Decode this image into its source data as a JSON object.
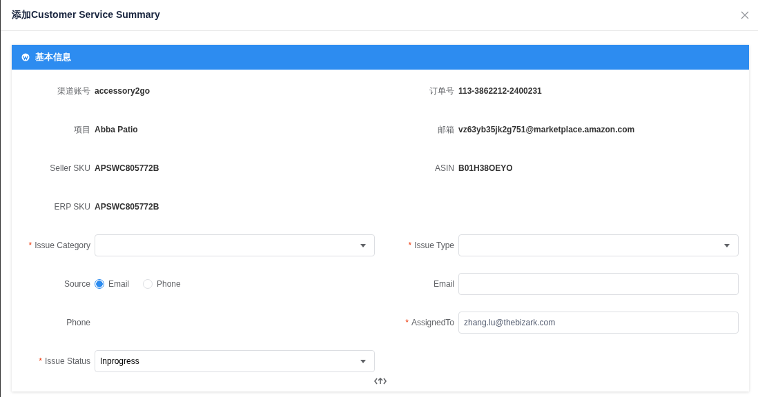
{
  "dialog": {
    "title": "添加Customer Service Summary"
  },
  "section": {
    "title": "基本信息"
  },
  "rows": [
    {
      "left": {
        "kind": "text",
        "label": "渠道账号",
        "value": "accessory2go"
      },
      "right": {
        "kind": "text",
        "label": "订单号",
        "value": "113-3862212-2400231"
      }
    },
    {
      "left": {
        "kind": "text",
        "label": "项目",
        "value": "Abba Patio"
      },
      "right": {
        "kind": "text",
        "label": "邮箱",
        "value": "vz63yb35jk2g751@marketplace.amazon.com"
      }
    },
    {
      "left": {
        "kind": "text",
        "label": "Seller SKU",
        "value": "APSWC805772B"
      },
      "right": {
        "kind": "text",
        "label": "ASIN",
        "value": "B01H38OEYO"
      }
    },
    {
      "left": {
        "kind": "text",
        "label": "ERP SKU",
        "value": "APSWC805772B"
      }
    },
    {
      "left": {
        "kind": "select",
        "label": "Issue Category",
        "required_mark": "*"
      },
      "right": {
        "kind": "select",
        "label": "Issue Type",
        "required_mark": "*"
      }
    },
    {
      "left": {
        "kind": "radio",
        "label": "Source",
        "options": [
          {
            "label": "Email",
            "selected": true
          },
          {
            "label": "Phone",
            "selected": false
          }
        ]
      },
      "right": {
        "kind": "input",
        "label": "Email"
      }
    },
    {
      "left": {
        "kind": "text",
        "label": "Phone"
      },
      "right": {
        "kind": "input",
        "label": "AssignedTo",
        "required_mark": "*",
        "value": "zhang.lu@thebizark.com"
      }
    },
    {
      "left": {
        "kind": "select",
        "label": "Issue Status",
        "required_mark": "*",
        "value": "Inprogress"
      }
    }
  ]
}
